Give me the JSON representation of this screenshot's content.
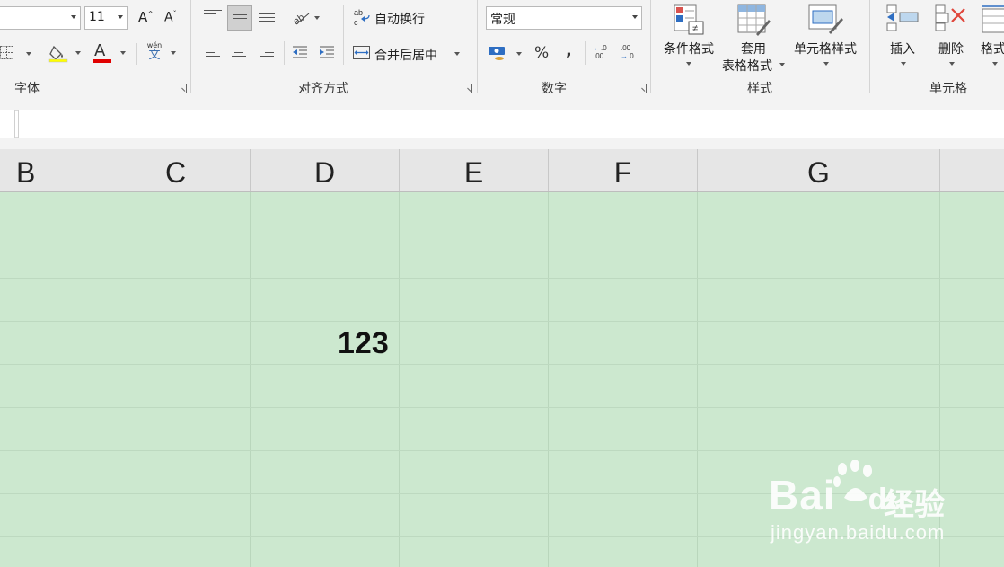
{
  "ribbon": {
    "font": {
      "font_name_value": "",
      "font_size_value": "11",
      "group_label": "字体"
    },
    "alignment": {
      "wrap_text_label": "自动换行",
      "merge_center_label": "合并后居中",
      "group_label": "对齐方式",
      "wrap_icon_text": "ab c"
    },
    "number": {
      "format_value": "常规",
      "percent_symbol": "%",
      "comma_symbol": ",",
      "inc_decimal_text": ".00",
      "group_label": "数字"
    },
    "styles": {
      "conditional_format_label": "条件格式",
      "table_format_line1": "套用",
      "table_format_line2": "表格格式",
      "cell_styles_label": "单元格样式",
      "group_label": "样式"
    },
    "cells": {
      "insert_label": "插入",
      "delete_label": "删除",
      "format_label": "格式",
      "group_label": "单元格"
    },
    "phonetic_text": "wén",
    "phonetic_char": "文",
    "font_color_letter": "A"
  },
  "columns": [
    "B",
    "C",
    "D",
    "E",
    "F",
    "G"
  ],
  "cell_d4_value": "123",
  "colors": {
    "grid_bg": "#cce8cf",
    "font_color_bar": "#e00000",
    "header_bg": "#e6e6e6"
  },
  "watermark": {
    "brand": "Bai",
    "brand2": "du",
    "cn": "经验",
    "url": "jingyan.baidu.com"
  }
}
